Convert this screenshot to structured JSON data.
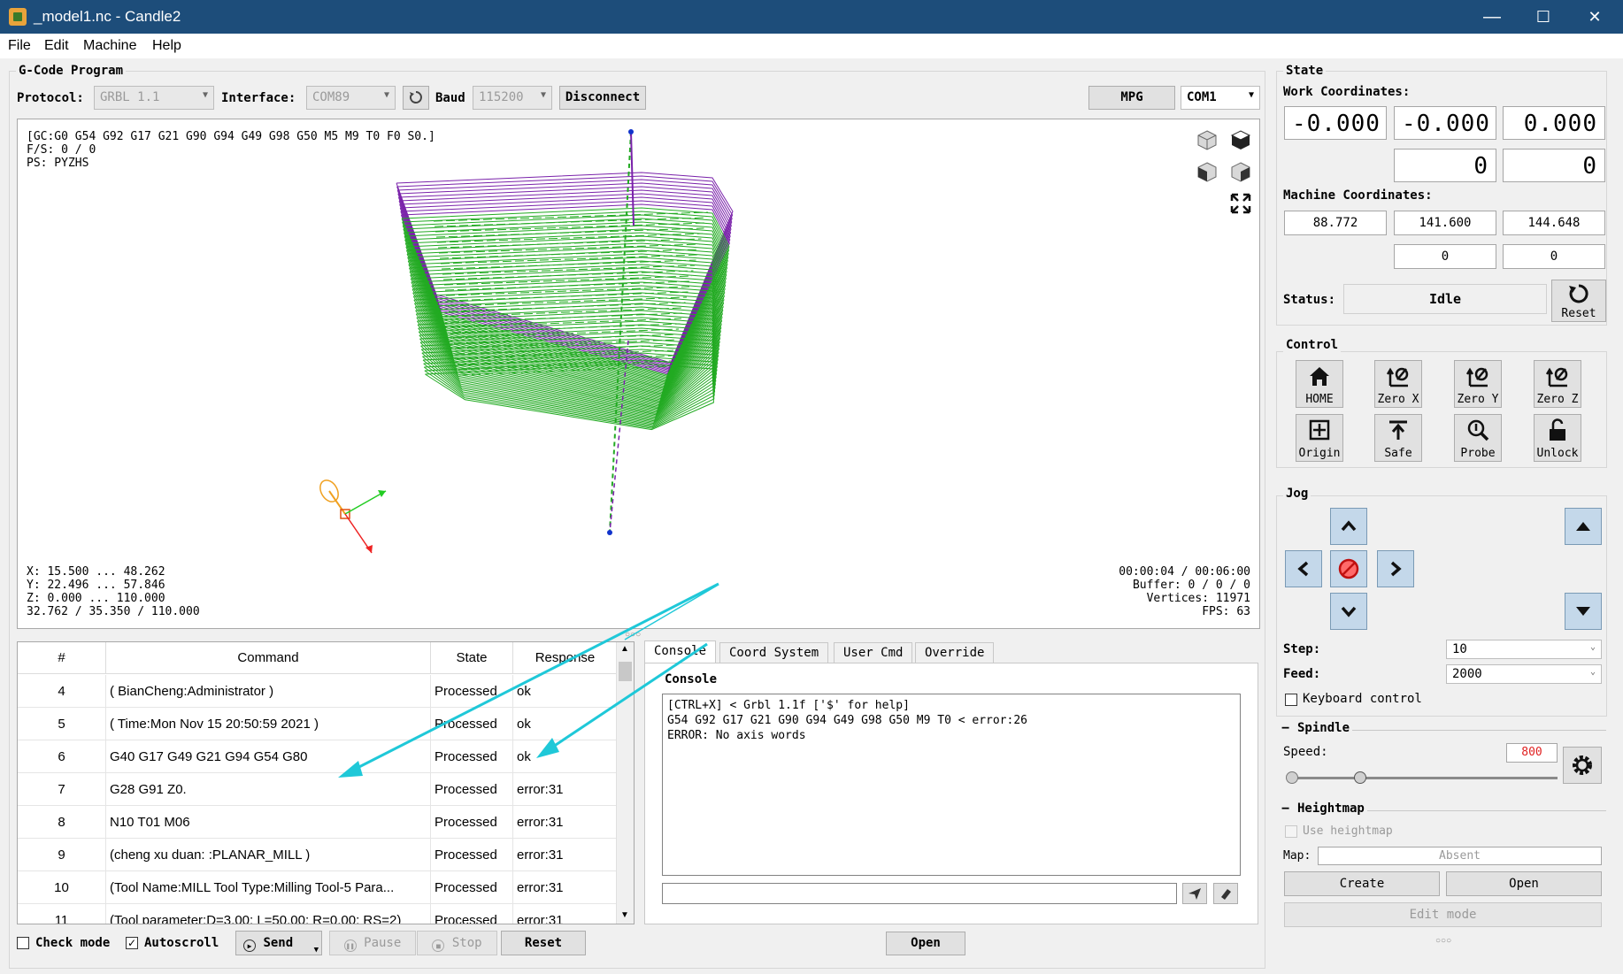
{
  "window": {
    "title": "_model1.nc - Candle2",
    "min": "—",
    "max": "☐",
    "close": "✕"
  },
  "menu": [
    "File",
    "Edit",
    "Machine",
    "Help"
  ],
  "gcode": {
    "group_title": "G-Code Program",
    "protocol_label": "Protocol:",
    "protocol_value": "GRBL 1.1",
    "interface_label": "Interface:",
    "interface_value": "COM89",
    "baud_label": "Baud",
    "baud_value": "115200",
    "disconnect": "Disconnect",
    "mpg": "MPG",
    "mpg_port": "COM1"
  },
  "viewer": {
    "top_info": "[GC:G0 G54 G92 G17 G21 G90 G94 G49 G98 G50 M5 M9 T0 F0 S0.]\nF/S: 0 / 0\nPS: PYZHS",
    "bottom_left": "X: 15.500 ... 48.262\nY: 22.496 ... 57.846\nZ: 0.000 ... 110.000\n32.762 / 35.350 / 110.000",
    "bottom_right": "00:00:04 / 00:06:00\nBuffer: 0 / 0 / 0\nVertices: 11971\nFPS: 63"
  },
  "table": {
    "headers": [
      "#",
      "Command",
      "State",
      "Response"
    ],
    "rows": [
      {
        "n": "4",
        "cmd": "( BianCheng:Administrator )",
        "state": "Processed",
        "resp": "ok"
      },
      {
        "n": "5",
        "cmd": "( Time:Mon Nov 15 20:50:59 2021 )",
        "state": "Processed",
        "resp": "ok"
      },
      {
        "n": "6",
        "cmd": "G40 G17 G49 G21 G94 G54 G80",
        "state": "Processed",
        "resp": "ok"
      },
      {
        "n": "7",
        "cmd": "G28 G91 Z0.",
        "state": "Processed",
        "resp": "error:31"
      },
      {
        "n": "8",
        "cmd": "N10 T01 M06",
        "state": "Processed",
        "resp": "error:31"
      },
      {
        "n": "9",
        "cmd": "(cheng xu duan: :PLANAR_MILL )",
        "state": "Processed",
        "resp": "error:31"
      },
      {
        "n": "10",
        "cmd": "(Tool Name:MILL Tool Type:Milling Tool-5 Para...",
        "state": "Processed",
        "resp": "error:31"
      },
      {
        "n": "11",
        "cmd": "(Tool parameter:D=3.00; L=50.00; R=0.00; RS=2)",
        "state": "Processed",
        "resp": "error:31"
      }
    ]
  },
  "bottom": {
    "check_mode": "Check mode",
    "autoscroll": "Autoscroll",
    "send": "Send",
    "pause": "Pause",
    "stop": "Stop",
    "reset": "Reset",
    "open": "Open"
  },
  "tabs": [
    "Console",
    "Coord System",
    "User Cmd",
    "Override"
  ],
  "console": {
    "title": "Console",
    "lines": "[CTRL+X] < Grbl 1.1f ['$' for help]\nG54 G92 G17 G21 G90 G94 G49 G98 G50 M9 T0 < error:26\nERROR: No axis words"
  },
  "state": {
    "title": "State",
    "work_label": "Work Coordinates:",
    "work": [
      "-0.000",
      "-0.000",
      "0.000"
    ],
    "work2": [
      "0",
      "0"
    ],
    "machine_label": "Machine Coordinates:",
    "machine": [
      "88.772",
      "141.600",
      "144.648"
    ],
    "machine2": [
      "0",
      "0"
    ],
    "status_label": "Status:",
    "status_value": "Idle",
    "reset": "Reset"
  },
  "control": {
    "title": "Control",
    "buttons": [
      "HOME",
      "Zero X",
      "Zero Y",
      "Zero Z",
      "Origin",
      "Safe",
      "Probe",
      "Unlock"
    ]
  },
  "jog": {
    "title": "Jog",
    "step_label": "Step:",
    "step_value": "10",
    "feed_label": "Feed:",
    "feed_value": "2000",
    "keyboard": "Keyboard control"
  },
  "spindle": {
    "title": "Spindle",
    "speed_label": "Speed:",
    "speed_value": "800"
  },
  "heightmap": {
    "title": "Heightmap",
    "use": "Use heightmap",
    "map_label": "Map:",
    "map_value": "Absent",
    "create": "Create",
    "open": "Open",
    "edit": "Edit mode"
  },
  "colors": {
    "titlebar": "#1d4d7a",
    "path_green": "#22aa22",
    "path_purple": "#7a22aa",
    "jog_blue": "#c4d8ea",
    "arrow_cyan": "#1fc8d8"
  }
}
